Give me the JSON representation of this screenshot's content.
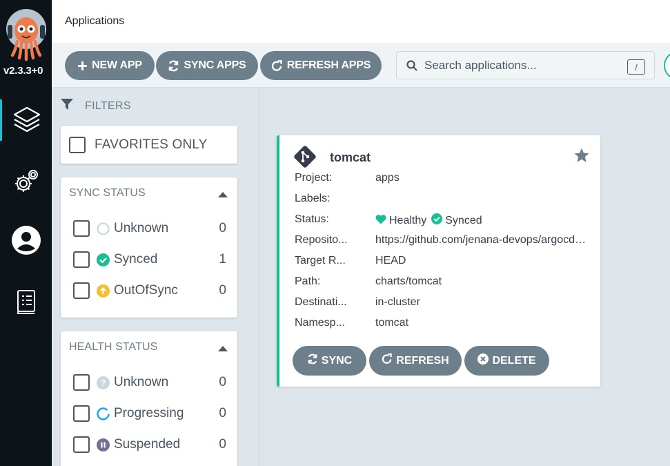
{
  "nav": {
    "version": "v2.3.3+0",
    "items": [
      {
        "name": "applications",
        "icon": "layers-icon",
        "active": true
      },
      {
        "name": "settings",
        "icon": "gear-icon",
        "active": false
      },
      {
        "name": "user-info",
        "icon": "user-icon",
        "active": false
      },
      {
        "name": "documentation",
        "icon": "docs-icon",
        "active": false
      }
    ]
  },
  "header": {
    "title": "Applications"
  },
  "toolbar": {
    "new_app": "NEW APP",
    "sync_apps": "SYNC APPS",
    "refresh_apps": "REFRESH APPS",
    "search_placeholder": "Search applications...",
    "search_shortcut": "/"
  },
  "filters": {
    "heading": "FILTERS",
    "favorites_only": "FAVORITES ONLY",
    "sync_status": {
      "title": "SYNC STATUS",
      "items": [
        {
          "label": "Unknown",
          "count": "0",
          "icon": "unknown-circle-icon"
        },
        {
          "label": "Synced",
          "count": "1",
          "icon": "check-circle-icon"
        },
        {
          "label": "OutOfSync",
          "count": "0",
          "icon": "arrow-up-circle-icon"
        }
      ]
    },
    "health_status": {
      "title": "HEALTH STATUS",
      "items": [
        {
          "label": "Unknown",
          "count": "0",
          "icon": "question-circle-icon"
        },
        {
          "label": "Progressing",
          "count": "0",
          "icon": "progress-circle-icon"
        },
        {
          "label": "Suspended",
          "count": "0",
          "icon": "pause-circle-icon"
        }
      ]
    }
  },
  "app": {
    "name": "tomcat",
    "fields": [
      {
        "key": "Project:",
        "value": "apps"
      },
      {
        "key": "Labels:",
        "value": ""
      },
      {
        "key": "Status:",
        "health": "Healthy",
        "sync": "Synced"
      },
      {
        "key": "Reposito...",
        "value": "https://github.com/jenana-devops/argocd-example-apps"
      },
      {
        "key": "Target R...",
        "value": "HEAD"
      },
      {
        "key": "Path:",
        "value": "charts/tomcat"
      },
      {
        "key": "Destinati...",
        "value": "in-cluster"
      },
      {
        "key": "Namesp...",
        "value": "tomcat"
      }
    ],
    "actions": {
      "sync": "SYNC",
      "refresh": "REFRESH",
      "delete": "DELETE"
    }
  },
  "colors": {
    "nav_bg": "#0c1419",
    "accent": "#1fbdd2",
    "healthy": "#18be94",
    "out_of_sync": "#f4c030",
    "progressing": "#0dadea",
    "suspended": "#766f94",
    "button": "#6d7f8b"
  }
}
